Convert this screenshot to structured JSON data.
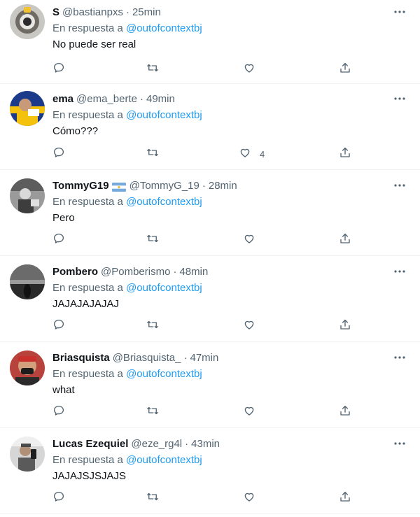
{
  "colors": {
    "accent": "#1d9bf0",
    "muted": "#536471",
    "text": "#0f1419",
    "divider": "#eff3f4"
  },
  "icons": {
    "reply": "reply-icon",
    "retweet": "retweet-icon",
    "like": "heart-icon",
    "share": "share-icon",
    "more": "more-icon"
  },
  "tweets": [
    {
      "name": "S",
      "handle": "@bastianpxs",
      "time": "25min",
      "reply_prefix": "En respuesta a",
      "reply_to": "@outofcontextbj",
      "text": "No puede ser real",
      "likes": ""
    },
    {
      "name": "ema",
      "handle": "@ema_berte",
      "time": "49min",
      "reply_prefix": "En respuesta a",
      "reply_to": "@outofcontextbj",
      "text": "Cómo???",
      "likes": "4"
    },
    {
      "name": "TommyG19",
      "handle": "@TommyG_19",
      "time": "28min",
      "reply_prefix": "En respuesta a",
      "reply_to": "@outofcontextbj",
      "text": "Pero",
      "likes": ""
    },
    {
      "name": "Pombero",
      "handle": "@Pomberismo",
      "time": "48min",
      "reply_prefix": "En respuesta a",
      "reply_to": "@outofcontextbj",
      "text": "JAJAJAJAJAJ",
      "likes": ""
    },
    {
      "name": "Briasquista",
      "handle": "@Briasquista_",
      "time": "47min",
      "reply_prefix": "En respuesta a",
      "reply_to": "@outofcontextbj",
      "text": "what",
      "likes": ""
    },
    {
      "name": "Lucas Ezequiel",
      "handle": "@eze_rg4l",
      "time": "43min",
      "reply_prefix": "En respuesta a",
      "reply_to": "@outofcontextbj",
      "text": "JAJAJSJSJAJS",
      "likes": ""
    }
  ]
}
